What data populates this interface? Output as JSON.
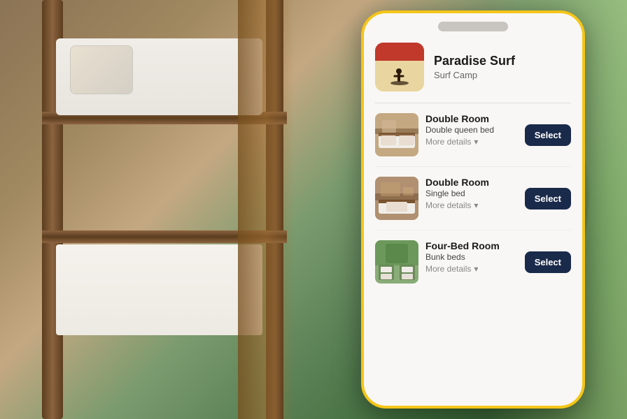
{
  "background": {
    "alt": "Bunk bed hostel room"
  },
  "phone": {
    "notch_bar_label": "notch",
    "hotel": {
      "name": "Paradise Surf",
      "category": "Surf Camp",
      "logo_icon": "🏄"
    },
    "rooms": [
      {
        "id": "room-1",
        "name": "Double Room",
        "bed_type": "Double queen bed",
        "more_details_label": "More details",
        "select_label": "Select",
        "thumb_color_top": "#a0826d",
        "thumb_color_bottom": "#c4a882"
      },
      {
        "id": "room-2",
        "name": "Double Room",
        "bed_type": "Single bed",
        "more_details_label": "More details",
        "select_label": "Select",
        "thumb_color_top": "#8b7355",
        "thumb_color_bottom": "#b09070"
      },
      {
        "id": "room-3",
        "name": "Four-Bed Room",
        "bed_type": "Bunk beds",
        "more_details_label": "More details",
        "select_label": "Select",
        "thumb_color_top": "#6b8c5a",
        "thumb_color_bottom": "#8aac78"
      }
    ]
  }
}
